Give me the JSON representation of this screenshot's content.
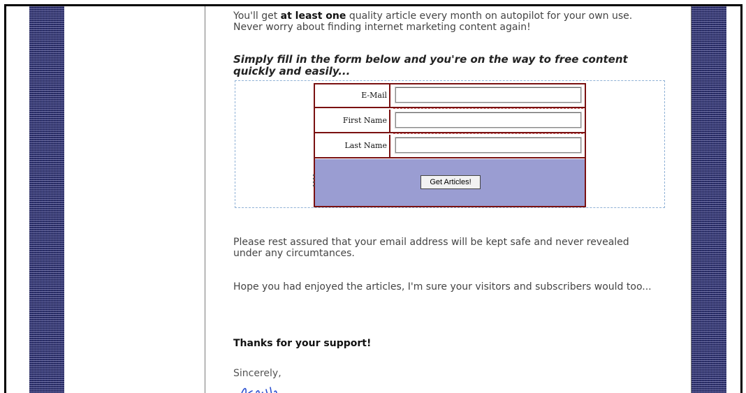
{
  "intro": {
    "prefix": "You'll get ",
    "bold": "at least one",
    "suffix": " quality article every month on autopilot for your own use. Never worry about finding internet marketing content again!"
  },
  "cta": "Simply fill in the form below and you're on the way to free content quickly and easily...",
  "form": {
    "email_label": "E-Mail",
    "first_name_label": "First Name",
    "last_name_label": "Last Name",
    "email_value": "",
    "first_name_value": "",
    "last_name_value": "",
    "submit_label": "Get Articles!"
  },
  "privacy_text": "Please rest assured that your email address will be kept safe and never revealed under any circumtances.",
  "hope_text": "Hope you had enjoyed the articles, I'm sure your visitors and subscribers would too...",
  "thanks_text": "Thanks for your support!",
  "sincerely_text": "Sincerely,",
  "colors": {
    "stripe": "#2b2f6a",
    "form_border": "#7a1111",
    "submit_bg": "#9a9dd2",
    "signature_ink": "#2a4fd0"
  },
  "icons": {
    "signature": "handwritten-signature",
    "resize_handle": "resize-handle-icon"
  }
}
